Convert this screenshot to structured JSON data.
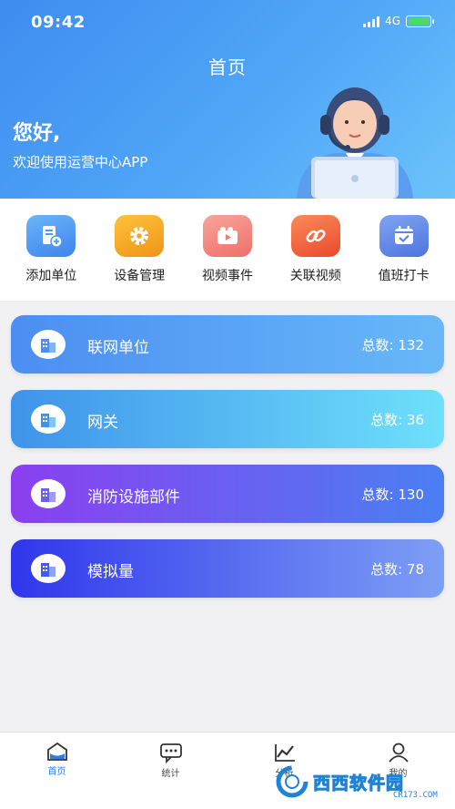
{
  "status": {
    "time": "09:42",
    "network": "4G"
  },
  "header": {
    "title": "首页",
    "greeting": "您好,",
    "welcome": "欢迎使用运营中心APP"
  },
  "quick_actions": [
    {
      "label": "添加单位",
      "icon": "add-unit-icon",
      "color": "#4e9cf2"
    },
    {
      "label": "设备管理",
      "icon": "gear-icon",
      "color": "#f6a422"
    },
    {
      "label": "视频事件",
      "icon": "video-icon",
      "color": "#f07c78"
    },
    {
      "label": "关联视频",
      "icon": "link-icon",
      "color": "#f15a3c"
    },
    {
      "label": "值班打卡",
      "icon": "calendar-check-icon",
      "color": "#5b84e6"
    }
  ],
  "cards": [
    {
      "title": "联网单位",
      "count_label": "总数:",
      "count": "132",
      "gradient": [
        "#4c8ef1",
        "#68b8f9"
      ]
    },
    {
      "title": "网关",
      "count_label": "总数:",
      "count": "36",
      "gradient": [
        "#3f93ea",
        "#6ee0fb"
      ]
    },
    {
      "title": "消防设施部件",
      "count_label": "总数:",
      "count": "130",
      "gradient": [
        "#8b3ff0",
        "#4a7ff2"
      ]
    },
    {
      "title": "模拟量",
      "count_label": "总数:",
      "count": "78",
      "gradient": [
        "#3036ec",
        "#7e9ff5"
      ]
    }
  ],
  "tabs": [
    {
      "label": "首页",
      "icon": "home-icon",
      "active": true
    },
    {
      "label": "统计",
      "icon": "chat-stats-icon",
      "active": false
    },
    {
      "label": "分析",
      "icon": "chart-icon",
      "active": false
    },
    {
      "label": "我的",
      "icon": "user-icon",
      "active": false
    }
  ],
  "watermark": {
    "text": "西西软件园",
    "sub": "CR173.COM"
  },
  "colors": {
    "accent": "#2f7ce8",
    "header_start": "#3f8df0",
    "header_end": "#6cc3fb"
  }
}
